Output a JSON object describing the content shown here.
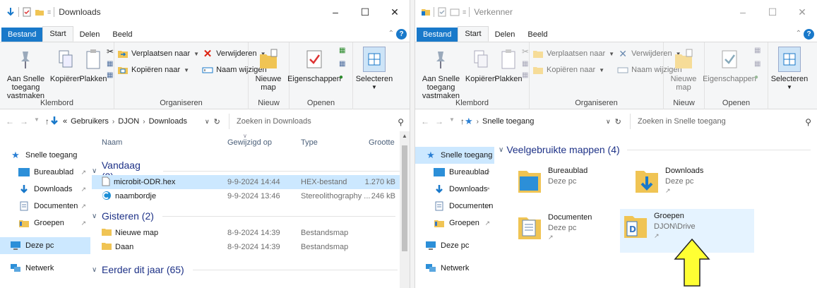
{
  "left": {
    "title": "Downloads",
    "tabs": {
      "file": "Bestand",
      "start": "Start",
      "share": "Delen",
      "view": "Beeld"
    },
    "ribbon": {
      "pin_label": "Aan Snelle toegang vastmaken",
      "copy_label": "Kopiëren",
      "paste_label": "Plakken",
      "clipboard_group": "Klembord",
      "move_label": "Verplaatsen naar",
      "copyto_label": "Kopiëren naar",
      "delete_label": "Verwijderen",
      "rename_label": "Naam wijzigen",
      "organize_group": "Organiseren",
      "newfolder_label": "Nieuwe map",
      "new_group": "Nieuw",
      "properties_label": "Eigenschappen",
      "open_group": "Openen",
      "select_label": "Selecteren"
    },
    "address": {
      "prefix": "«",
      "crumb1": "Gebruikers",
      "crumb2": "DJON",
      "crumb3": "Downloads"
    },
    "search_placeholder": "Zoeken in Downloads",
    "nav": {
      "quick_access": "Snelle toegang",
      "desktop": "Bureaublad",
      "downloads": "Downloads",
      "documents": "Documenten",
      "groups": "Groepen",
      "this_pc": "Deze pc",
      "network": "Netwerk"
    },
    "columns": {
      "name": "Naam",
      "modified": "Gewijzigd op",
      "type": "Type",
      "size": "Grootte"
    },
    "groups": {
      "today": "Vandaag (2)",
      "yesterday": "Gisteren (2)",
      "earlier": "Eerder dit jaar (65)"
    },
    "files": [
      {
        "name": "microbit-ODR.hex",
        "modified": "9-9-2024 14:44",
        "type": "HEX-bestand",
        "size": "1.270 kB"
      },
      {
        "name": "naambordje",
        "modified": "9-9-2024 13:46",
        "type": "Stereolithography ...",
        "size": "246 kB"
      },
      {
        "name": "Nieuwe map",
        "modified": "8-9-2024 14:39",
        "type": "Bestandsmap",
        "size": ""
      },
      {
        "name": "Daan",
        "modified": "8-9-2024 14:39",
        "type": "Bestandsmap",
        "size": ""
      }
    ]
  },
  "right": {
    "title": "Verkenner",
    "tabs": {
      "file": "Bestand",
      "start": "Start",
      "share": "Delen",
      "view": "Beeld"
    },
    "ribbon": {
      "pin_label": "Aan Snelle toegang vastmaken",
      "copy_label": "Kopiëren",
      "paste_label": "Plakken",
      "clipboard_group": "Klembord",
      "move_label": "Verplaatsen naar",
      "copyto_label": "Kopiëren naar",
      "delete_label": "Verwijderen",
      "rename_label": "Naam wijzigen",
      "organize_group": "Organiseren",
      "newfolder_label": "Nieuwe map",
      "new_group": "Nieuw",
      "properties_label": "Eigenschappen",
      "open_group": "Openen",
      "select_label": "Selecteren"
    },
    "address": {
      "crumb1": "Snelle toegang"
    },
    "search_placeholder": "Zoeken in Snelle toegang",
    "nav": {
      "quick_access": "Snelle toegang",
      "desktop": "Bureaublad",
      "downloads": "Downloads",
      "documents": "Documenten",
      "groups": "Groepen",
      "this_pc": "Deze pc",
      "network": "Netwerk"
    },
    "group_title": "Veelgebruikte mappen (4)",
    "tiles": [
      {
        "name": "Bureaublad",
        "sub": "Deze pc"
      },
      {
        "name": "Downloads",
        "sub": "Deze pc"
      },
      {
        "name": "Documenten",
        "sub": "Deze pc"
      },
      {
        "name": "Groepen",
        "sub": "DJON\\Drive"
      }
    ]
  },
  "colors": {
    "accent": "#1979ca",
    "selection": "#cce8ff",
    "folder": "#f0c454",
    "arrow": "#ffff33"
  }
}
